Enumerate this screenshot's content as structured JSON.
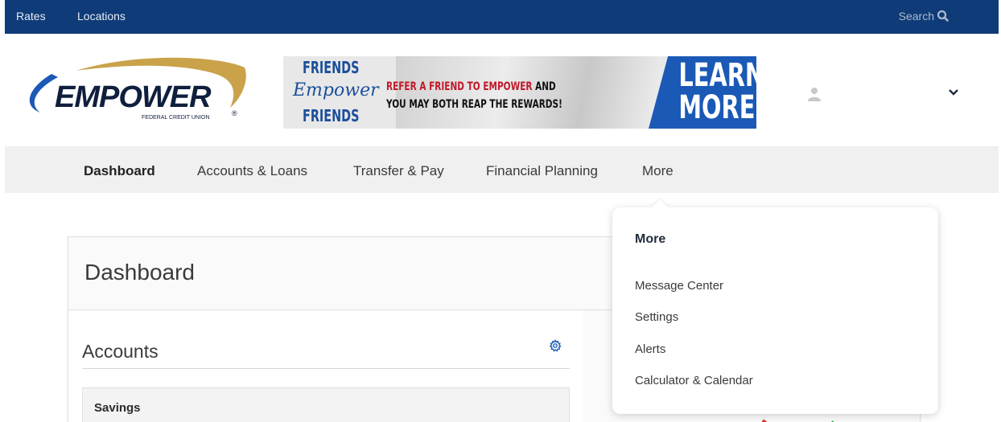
{
  "topbar": {
    "links": [
      "Rates",
      "Locations"
    ],
    "search_label": "Search"
  },
  "logo": {
    "word": "EMPOWER",
    "subtitle": "FEDERAL CREDIT UNION",
    "registered": "®"
  },
  "banner": {
    "friends_top": "FRIENDS",
    "script_word": "Empower",
    "friends_bottom": "FRIENDS",
    "line1_red": "REFER A FRIEND TO EMPOWER",
    "line1_dark": " AND",
    "line2": "YOU MAY BOTH REAP THE REWARDS!",
    "cta_line1": "LEARN",
    "cta_line2": "MORE"
  },
  "nav": {
    "items": [
      "Dashboard",
      "Accounts & Loans",
      "Transfer & Pay",
      "Financial Planning",
      "More"
    ],
    "active": "Dashboard"
  },
  "dashboard": {
    "title": "Dashboard",
    "accounts_title": "Accounts",
    "savings_label": "Savings"
  },
  "more_menu": {
    "heading": "More",
    "items": [
      "Message Center",
      "Settings",
      "Alerts",
      "Calculator & Calendar"
    ]
  },
  "colors": {
    "topbar": "#0f3c78",
    "brand_blue": "#1b59b6",
    "banner_red": "#c0182a",
    "logo_gold": "#c9a24a"
  },
  "icons": {
    "search": "search-icon",
    "avatar": "user-icon",
    "profile_menu": "chevron-down-icon",
    "accounts_settings": "gear-icon"
  }
}
